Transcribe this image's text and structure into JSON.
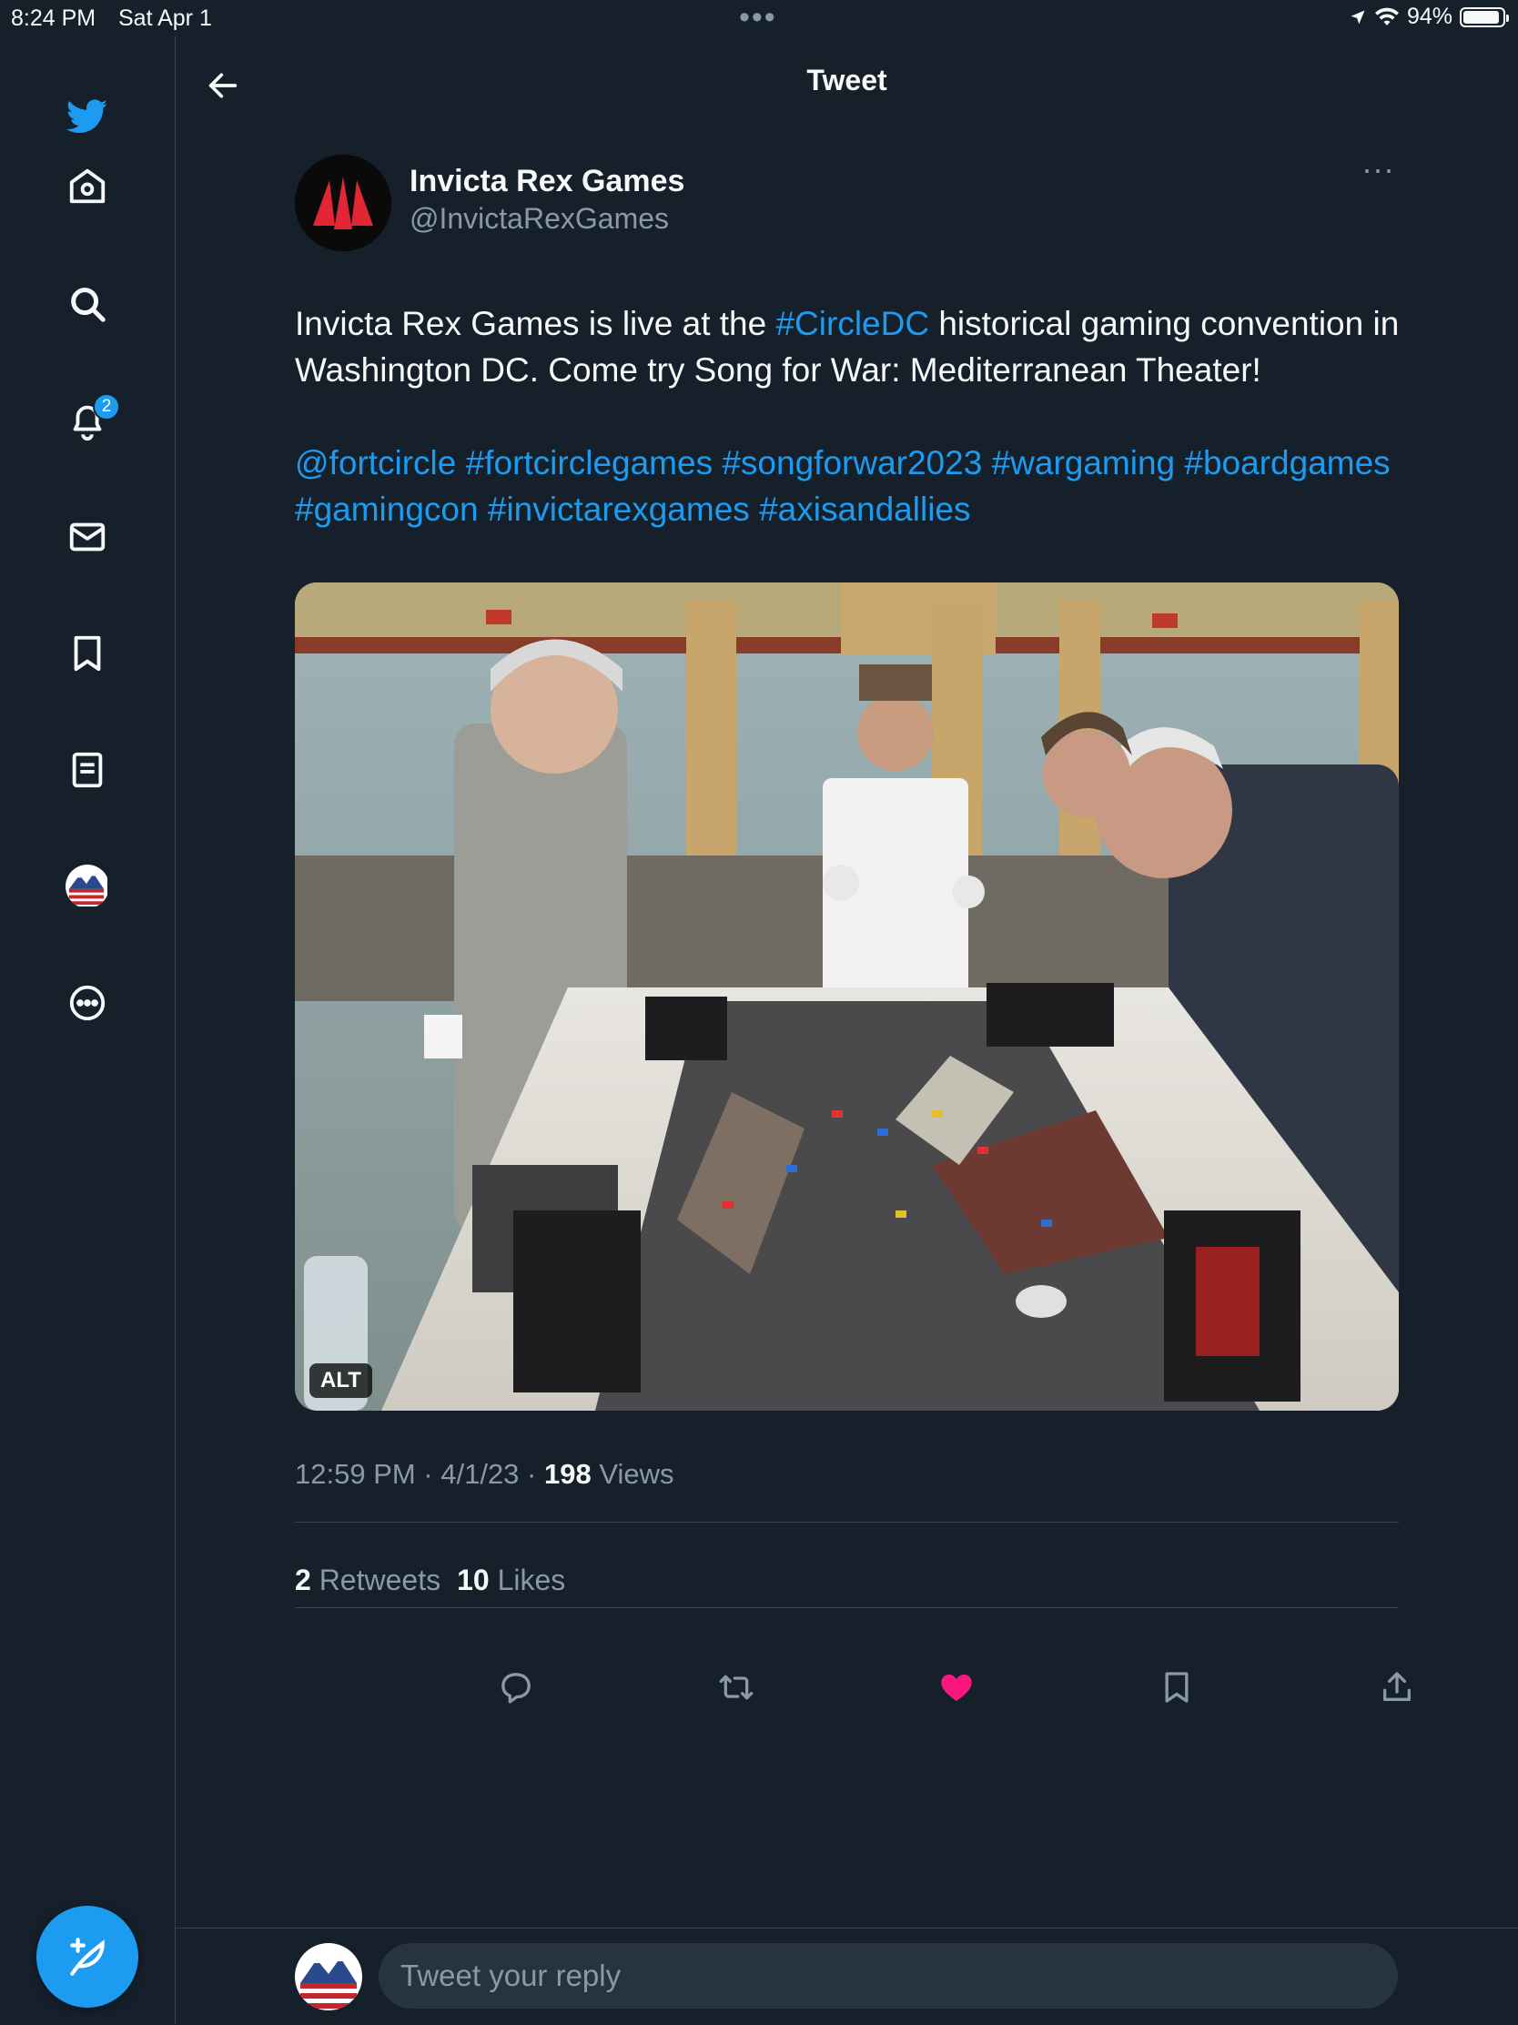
{
  "status_bar": {
    "time": "8:24 PM",
    "date": "Sat Apr 1",
    "battery": "94%",
    "battery_level": 0.94
  },
  "sidebar": {
    "items": [
      {
        "name": "twitter-logo",
        "icon": "twitter-bird-icon"
      },
      {
        "name": "home",
        "icon": "home-icon"
      },
      {
        "name": "explore",
        "icon": "search-icon"
      },
      {
        "name": "notifications",
        "icon": "bell-icon",
        "badge": "2"
      },
      {
        "name": "messages",
        "icon": "mail-icon"
      },
      {
        "name": "bookmarks",
        "icon": "bookmark-icon"
      },
      {
        "name": "lists",
        "icon": "list-icon"
      },
      {
        "name": "profile",
        "icon": "avatar"
      },
      {
        "name": "more",
        "icon": "more-circle-icon"
      }
    ],
    "compose_icon": "compose-feather-icon"
  },
  "header": {
    "title": "Tweet"
  },
  "tweet": {
    "author_name": "Invicta Rex Games",
    "author_handle": "@InvictaRexGames",
    "text_part1": "Invicta Rex Games is live at the ",
    "hashtag_circledc": "#CircleDC",
    "text_part2": " historical gaming convention in Washington DC. Come try Song for War: Mediterranean Theater!",
    "tags": [
      "@fortcircle",
      "#fortcirclegames",
      "#songforwar2023",
      "#wargaming",
      "#boardgames",
      "#gamingcon",
      "#invictarexgames",
      "#axisandallies"
    ],
    "alt_label": "ALT",
    "timestamp": "12:59 PM · 4/1/23 · ",
    "views_count": "198",
    "views_label": " Views",
    "retweets_count": "2",
    "retweets_label": "Retweets",
    "likes_count": "10",
    "likes_label": "Likes"
  },
  "actions": [
    "reply-icon",
    "retweet-icon",
    "like-icon",
    "bookmark-icon",
    "share-icon"
  ],
  "reply": {
    "placeholder": "Tweet your reply"
  },
  "colors": {
    "background": "#15202b",
    "accent": "#1d9bf0",
    "like": "#f91880",
    "muted": "#8b98a5",
    "border": "#38444d"
  }
}
